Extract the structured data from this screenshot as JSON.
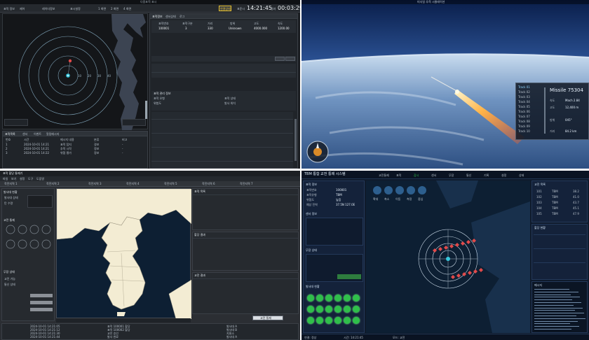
{
  "q1": {
    "window_title": "다중표적 표시",
    "toolbar_items": [
      "표적 정보",
      "제어",
      "레이더정보",
      "표시설정"
    ],
    "mode_buttons": [
      "1 화면",
      "2 화면",
      "4 화면"
    ],
    "status_button": "연결상태",
    "time_label_1": "표준시",
    "time_value_1": "14:21:45",
    "time_label_2": "경과",
    "time_value_2": "00:03:29",
    "range_rings": [
      "10",
      "20",
      "30",
      "40"
    ],
    "right_tabs": [
      "표적정보",
      "센서상태",
      "로그"
    ],
    "target_table_headers": [
      "표적번호",
      "표적구분",
      "거리",
      "방위",
      "고도",
      "속도"
    ],
    "target_row": [
      "100001",
      "3",
      "330",
      "Unknown",
      "4000.000",
      "1200.00"
    ],
    "log_section_title": "표적 관리 정보",
    "info_labels": [
      "표적 유형",
      "표적 상태",
      "위험도",
      "발사 위치"
    ],
    "bottom_tabs": [
      "표적목록",
      "센서",
      "이벤트",
      "알림메시지"
    ],
    "bottom_headers": [
      "번호",
      "시간",
      "메시지 내용",
      "분류",
      "비고"
    ],
    "bottom_rows": [
      [
        "1",
        "2024-10-01 14:21",
        "표적 탐지",
        "경보",
        "-"
      ],
      [
        "2",
        "2024-10-01 14:21",
        "추적 시작",
        "정보",
        "-"
      ],
      [
        "3",
        "2024-10-01 14:22",
        "위협 평가",
        "정보",
        "-"
      ]
    ]
  },
  "q2": {
    "top_title": "미사일 추적 시뮬레이션",
    "panel_title": "Missile 75304",
    "panel_rows": [
      [
        "속도",
        "Mach 2.84"
      ],
      [
        "고도",
        "12,400 m"
      ],
      [
        "방위",
        "045°"
      ],
      [
        "거리",
        "84.2 km"
      ]
    ],
    "list_items": [
      "Track 01",
      "Track 02",
      "Track 03",
      "Track 04",
      "Track 05",
      "Track 06",
      "Track 07",
      "Track 08",
      "Track 09",
      "Track 10"
    ]
  },
  "q3": {
    "window_title": "표적 할당 통제기",
    "menu_items": [
      "파일",
      "보기",
      "설정",
      "도구",
      "도움말"
    ],
    "tab_labels": [
      "작전지역 1",
      "작전지역 2",
      "작전지역 3",
      "작전지역 4",
      "작전지역 5",
      "작전지역 6",
      "작전지역 7"
    ],
    "left_labels": [
      "발사대 상태",
      "탄 수량",
      "교전 가능",
      "통신 상태"
    ],
    "left_section_titles": [
      "발사대 현황",
      "교전 통제",
      "무장 상태"
    ],
    "right_section_titles": [
      "표적 목록",
      "할당 결과",
      "교전 결과"
    ],
    "bottom_rows": [
      [
        "2024-10-01 14:21:05",
        "표적 100001 할당",
        "발사대 A"
      ],
      [
        "2024-10-01 14:21:12",
        "표적 100002 할당",
        "발사대 B"
      ],
      [
        "2024-10-01 14:21:30",
        "교전 승인",
        "지휘소"
      ],
      [
        "2024-10-01 14:21:44",
        "발사 완료",
        "발사대 A"
      ]
    ],
    "status_button": "교전 통제"
  },
  "q4": {
    "window_title": "TBM 통합 교전 통제 시스템",
    "top_tabs": [
      "교전통제",
      "표적",
      "감시",
      "센서",
      "무장",
      "통신",
      "기록",
      "설정",
      "상태"
    ],
    "left_section_titles": [
      "표적 정보",
      "센서 정보",
      "무장 상태",
      "발사대 현황"
    ],
    "left_rows": [
      [
        "표적번호",
        "100001"
      ],
      [
        "표적유형",
        "TBM"
      ],
      [
        "위협도",
        "높음"
      ],
      [
        "예상 탄착",
        "37.5N 127.0E"
      ]
    ],
    "launcher_count": 18,
    "right_section_titles": [
      "교전 목록",
      "할당 현황",
      "메시지"
    ],
    "right_table": [
      [
        "101",
        "TBM",
        "38.2"
      ],
      [
        "102",
        "TBM",
        "41.0"
      ],
      [
        "103",
        "TBM",
        "43.7"
      ],
      [
        "104",
        "TBM",
        "45.1"
      ],
      [
        "105",
        "TBM",
        "47.9"
      ]
    ],
    "map_controls": [
      "확대",
      "축소",
      "이동",
      "측정",
      "중심"
    ],
    "bottom_status": [
      "연결: 정상",
      "시간: 14:21:45",
      "모드: 교전"
    ],
    "log_lines": 16
  },
  "colors": {
    "radar_ring": "#7fa3b8",
    "target_red": "#e24a4a",
    "target_cyan": "#37c8dd",
    "status_green": "#2fbf4a",
    "sea_blue": "#0d1f33",
    "land_beige": "#f3ecd3",
    "accent_yellow": "#e8c02c"
  }
}
